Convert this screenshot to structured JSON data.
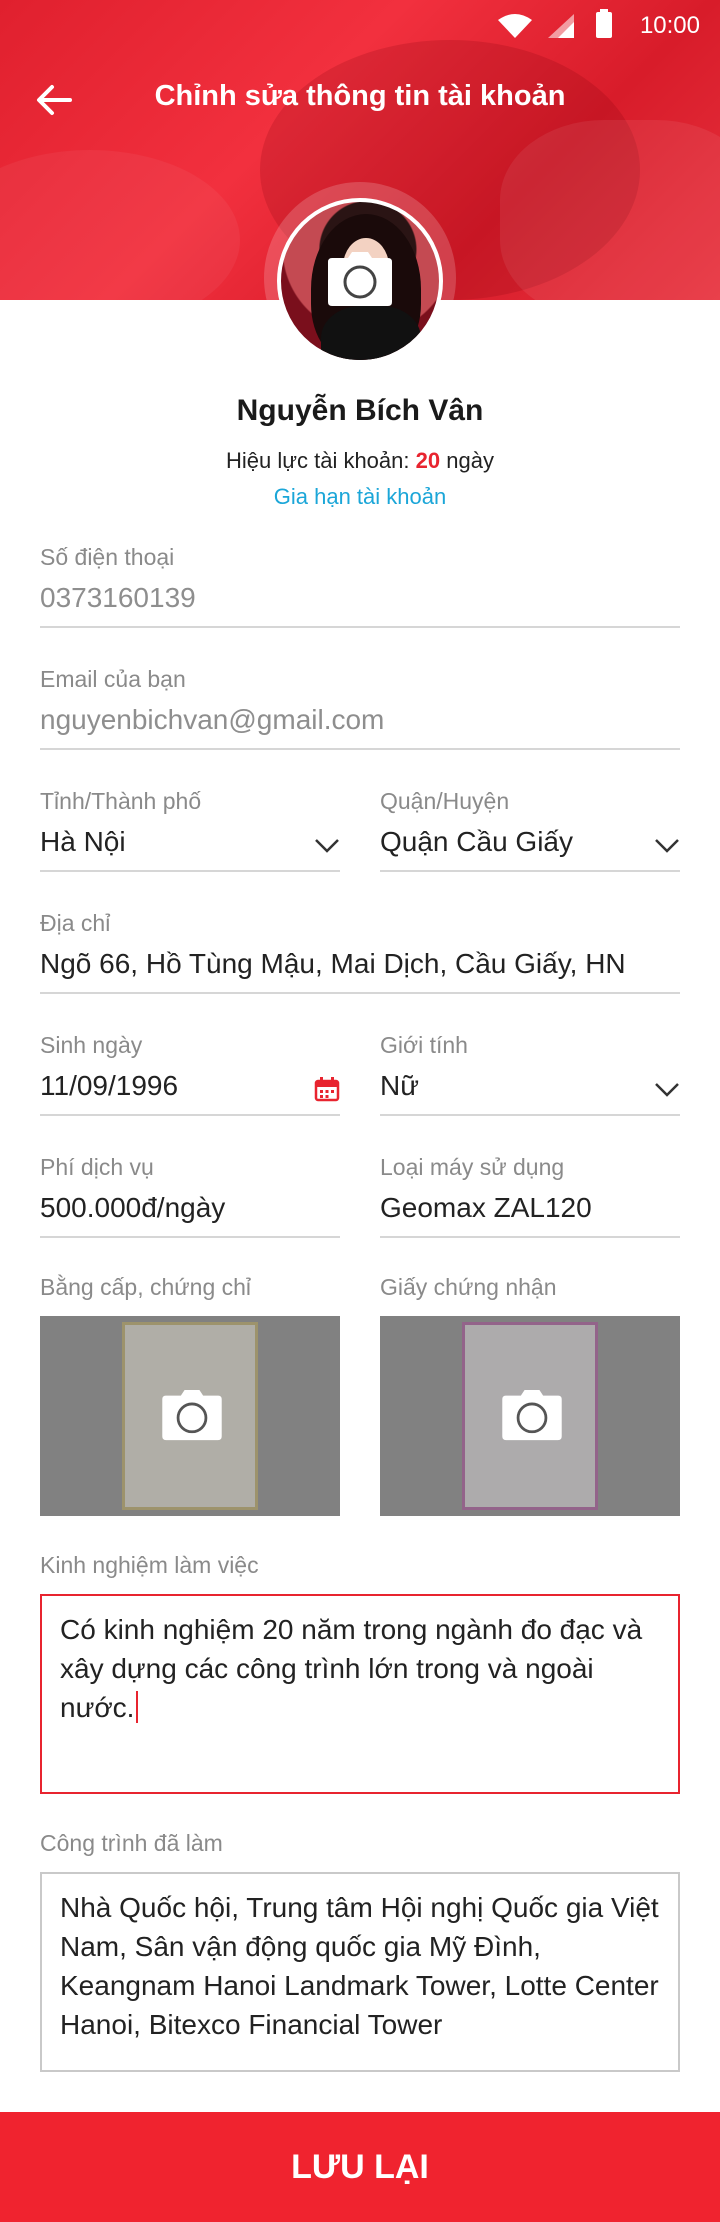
{
  "status_bar": {
    "time": "10:00"
  },
  "header": {
    "title": "Chỉnh sửa thông tin tài khoản"
  },
  "profile": {
    "name": "Nguyễn Bích Vân",
    "validity_label": "Hiệu lực tài khoản:",
    "validity_days": "20",
    "validity_unit": "ngày",
    "renew_link": "Gia hạn tài khoản"
  },
  "fields": {
    "phone": {
      "label": "Số điện thoại",
      "value": "0373160139"
    },
    "email": {
      "label": "Email của bạn",
      "value": "nguyenbichvan@gmail.com"
    },
    "province": {
      "label": "Tỉnh/Thành phố",
      "value": "Hà Nội"
    },
    "district": {
      "label": "Quận/Huyện",
      "value": "Quận Cầu Giấy"
    },
    "address": {
      "label": "Địa chỉ",
      "value": "Ngõ 66, Hồ Tùng Mậu, Mai Dịch, Cầu Giấy, HN"
    },
    "birthday": {
      "label": "Sinh ngày",
      "value": "11/09/1996"
    },
    "gender": {
      "label": "Giới tính",
      "value": "Nữ"
    },
    "service_fee": {
      "label": "Phí dịch vụ",
      "value": "500.000đ/ngày"
    },
    "device": {
      "label": "Loại máy sử dụng",
      "value": "Geomax ZAL120"
    },
    "degrees": {
      "label": "Bằng cấp, chứng chỉ"
    },
    "certificates": {
      "label": "Giấy chứng nhận"
    },
    "experience": {
      "label": "Kinh nghiệm làm việc",
      "value": "Có kinh nghiệm 20 năm trong ngành đo đạc và xây dựng các công trình lớn trong và ngoài nước."
    },
    "projects": {
      "label": "Công trình đã làm",
      "value": "Nhà Quốc hội, Trung tâm Hội nghị Quốc gia Việt Nam, Sân vận động quốc gia Mỹ Đình, Keangnam Hanoi Landmark Tower, Lotte Center Hanoi, Bitexco Financial Tower"
    }
  },
  "actions": {
    "save_label": "LƯU LẠI"
  },
  "colors": {
    "accent": "#f0232f",
    "link": "#1ba6d8",
    "label": "#8a8a8a"
  }
}
